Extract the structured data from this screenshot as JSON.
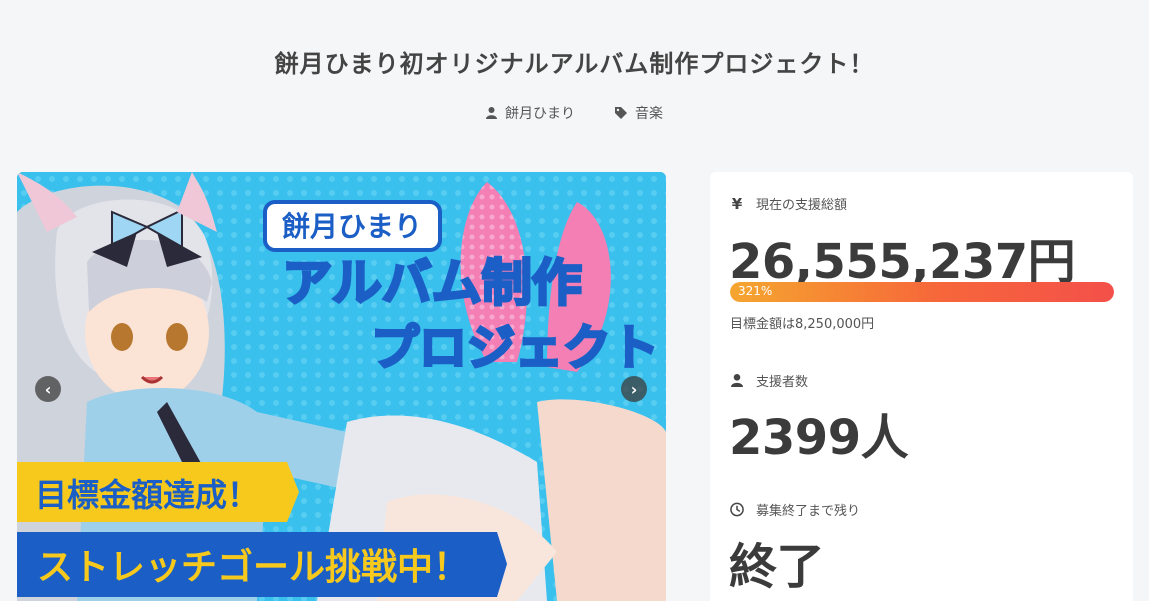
{
  "project": {
    "title": "餅月ひまり初オリジナルアルバム制作プロジェクト！",
    "author": "餅月ひまり",
    "category": "音楽"
  },
  "carousel": {
    "banner_name": "餅月ひまり",
    "banner_line1": "アルバム制作",
    "banner_line2": "プロジェクト",
    "ribbon1": "目標金額達成！",
    "ribbon2": "ストレッチゴール挑戦中！",
    "prev_label": "‹",
    "next_label": "›"
  },
  "stats": {
    "total_label": "現在の支援総額",
    "total_value": "26,555,237円",
    "progress_text": "321%",
    "progress_fraction": 1.0,
    "goal_text": "目標金額は8,250,000円",
    "backers_label": "支援者数",
    "backers_value": "2399人",
    "remaining_label": "募集終了まで残り",
    "remaining_value": "終了"
  },
  "icons": {
    "author": "user-icon",
    "category": "tag-icon",
    "currency": "yen-icon",
    "backers": "user-icon",
    "clock": "clock-icon"
  },
  "colors": {
    "progress_start": "#f5a62f",
    "progress_end": "#f4504a",
    "banner_pink": "#f0508e",
    "banner_blue": "#1e6fd8",
    "ribbon_yellow": "#f7c91c"
  }
}
